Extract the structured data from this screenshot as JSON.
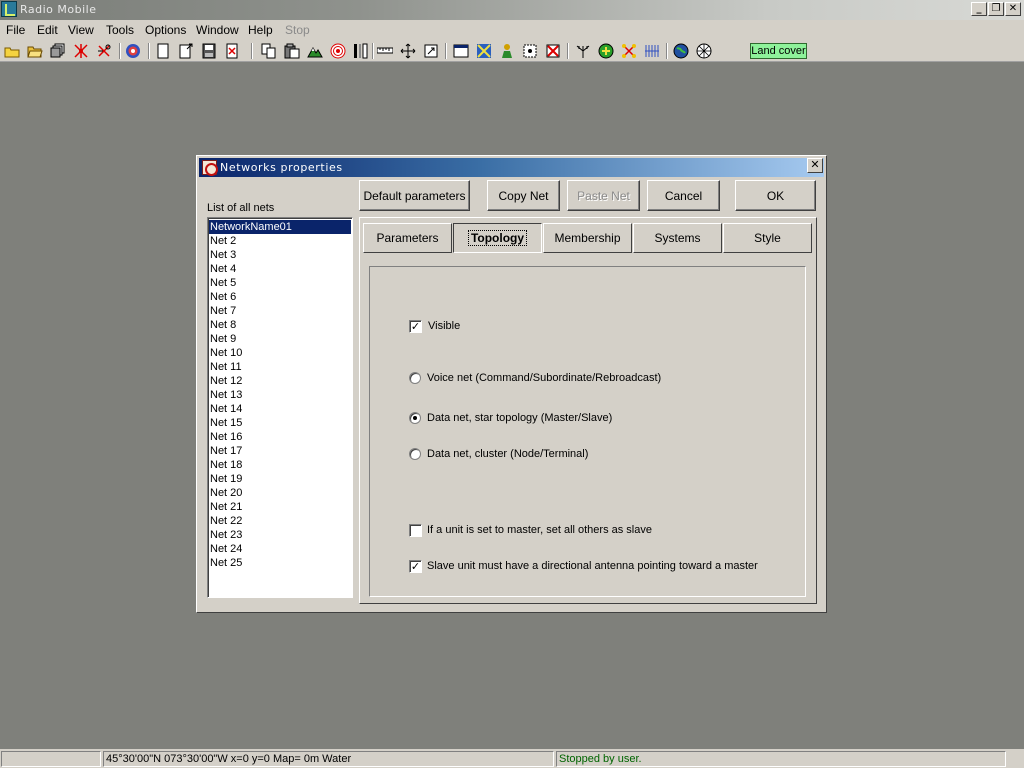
{
  "app": {
    "title": "Radio Mobile",
    "window_buttons": [
      "_",
      "❐",
      "✕"
    ]
  },
  "menu": [
    {
      "label": "File"
    },
    {
      "label": "Edit"
    },
    {
      "label": "View"
    },
    {
      "label": "Tools"
    },
    {
      "label": "Options"
    },
    {
      "label": "Window"
    },
    {
      "label": "Help"
    },
    {
      "label": "Stop",
      "disabled": true
    }
  ],
  "toolbar": {
    "icons": [
      "new-folder-icon",
      "open-folder-icon",
      "copy-stack-icon",
      "network-icon",
      "tools-network-icon",
      "radar-icon",
      "page-icon",
      "page-arrow-icon",
      "save-icon",
      "close-page-icon",
      "copy-icon",
      "paste-icon",
      "terrain-icon",
      "target-icon",
      "bar-icon",
      "ruler-icon",
      "move-icon",
      "crop-icon",
      "window-icon",
      "map-icon",
      "person-icon",
      "frame-icon",
      "delete-frame-icon",
      "antenna-icon",
      "green-circle-icon",
      "cluster-icon",
      "hatch-icon",
      "globe-icon",
      "grid-globe-icon"
    ],
    "land_cover_label": "Land cover"
  },
  "dialog": {
    "title": "Networks properties",
    "close_label": "✕",
    "buttons": {
      "default_params": "Default parameters",
      "copy_net": "Copy Net",
      "paste_net": "Paste Net",
      "cancel": "Cancel",
      "ok": "OK"
    },
    "list_label": "List of all nets",
    "nets": [
      "NetworkName01",
      "Net  2",
      "Net  3",
      "Net  4",
      "Net  5",
      "Net  6",
      "Net  7",
      "Net  8",
      "Net  9",
      "Net 10",
      "Net 11",
      "Net 12",
      "Net 13",
      "Net 14",
      "Net 15",
      "Net 16",
      "Net 17",
      "Net 18",
      "Net 19",
      "Net 20",
      "Net 21",
      "Net 22",
      "Net 23",
      "Net 24",
      "Net 25"
    ],
    "tabs": [
      "Parameters",
      "Topology",
      "Membership",
      "Systems",
      "Style"
    ],
    "topology": {
      "visible_label": "Visible",
      "visible_checked": true,
      "radio_voice": "Voice net (Command/Subordinate/Rebroadcast)",
      "radio_star": "Data net, star topology (Master/Slave)",
      "radio_cluster": "Data net, cluster (Node/Terminal)",
      "selected_radio": "star",
      "master_label": "If a unit is set to master, set all others as slave",
      "master_checked": false,
      "slave_label": "Slave unit must have a directional antenna pointing toward a master",
      "slave_checked": true
    }
  },
  "status": {
    "coords": "45°30'00\"N  073°30'00\"W   x=0 y=0 Map= 0m Water",
    "message": "Stopped by user."
  }
}
